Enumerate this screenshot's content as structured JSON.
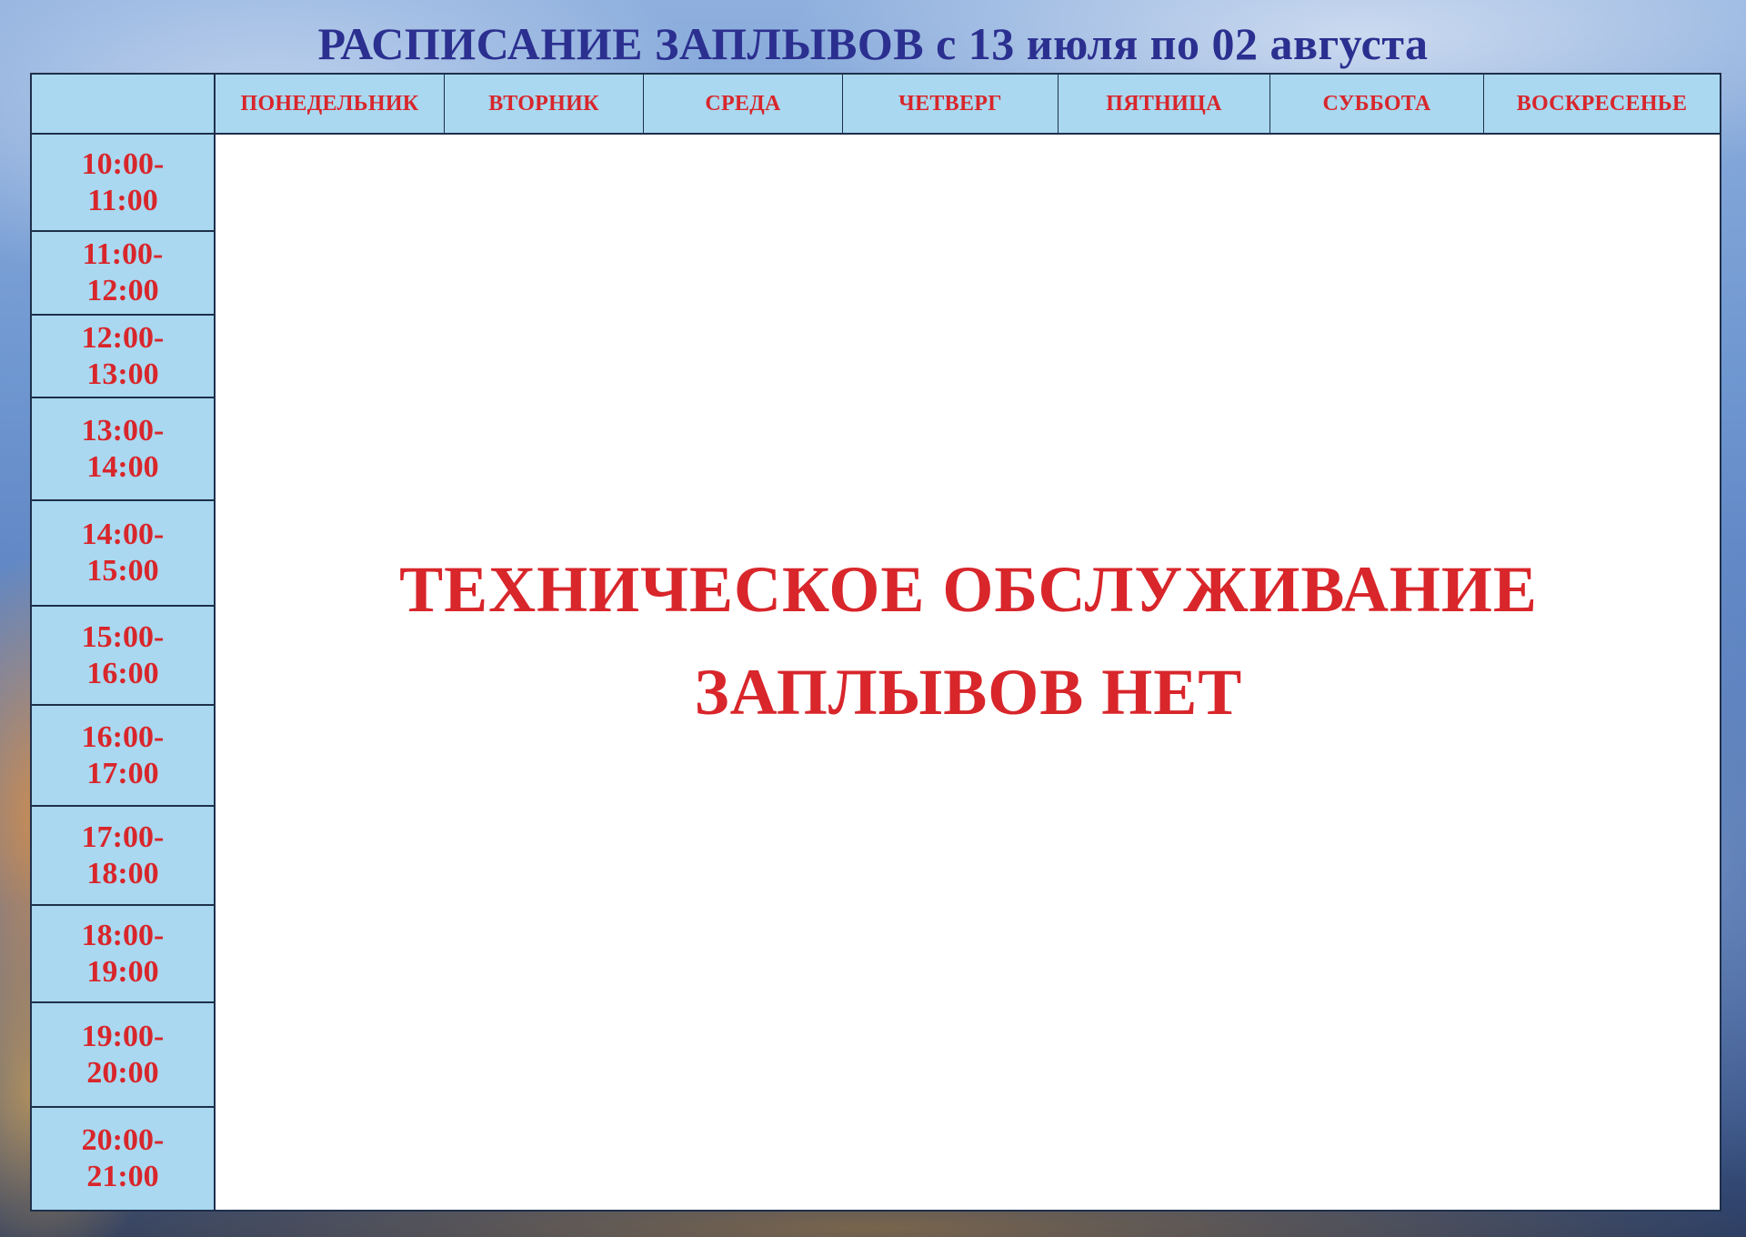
{
  "title": "РАСПИСАНИЕ ЗАПЛЫВОВ с 13 июля по 02 августа",
  "colors": {
    "title": "#2b2f8f",
    "accent_red": "#d8262b",
    "cell_blue": "#a9d8f0",
    "grid_line": "#1f2f4a"
  },
  "days": [
    "ПОНЕДЕЛЬНИК",
    "ВТОРНИК",
    "СРЕДА",
    "ЧЕТВЕРГ",
    "ПЯТНИЦА",
    "СУББОТА",
    "ВОСКРЕСЕНЬЕ"
  ],
  "time_slots": [
    {
      "start": "10:00-",
      "end": "11:00"
    },
    {
      "start": "11:00-",
      "end": "12:00"
    },
    {
      "start": "12:00-",
      "end": "13:00"
    },
    {
      "start": "13:00-",
      "end": "14:00"
    },
    {
      "start": "14:00-",
      "end": "15:00"
    },
    {
      "start": "15:00-",
      "end": "16:00"
    },
    {
      "start": "16:00-",
      "end": "17:00"
    },
    {
      "start": "17:00-",
      "end": "18:00"
    },
    {
      "start": "18:00-",
      "end": "19:00"
    },
    {
      "start": "19:00-",
      "end": "20:00"
    },
    {
      "start": "20:00-",
      "end": "21:00"
    }
  ],
  "notice": {
    "line1": "ТЕХНИЧЕСКОЕ ОБСЛУЖИВАНИЕ",
    "line2": "ЗАПЛЫВОВ НЕТ"
  }
}
